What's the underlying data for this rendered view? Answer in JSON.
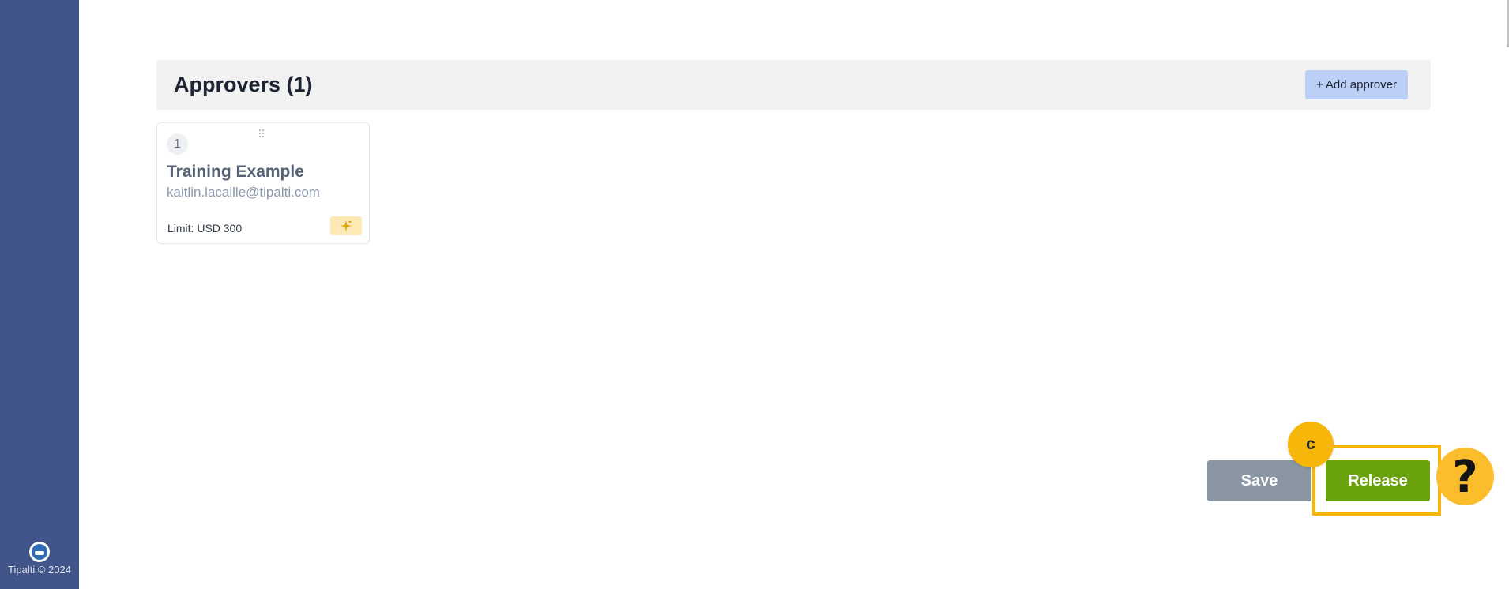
{
  "sidebar": {
    "copyright": "Tipalti © 2024"
  },
  "approvers": {
    "title": "Approvers (1)",
    "add_button_label": "+ Add approver",
    "items": [
      {
        "order": "1",
        "name": "Training Example",
        "email": "kaitlin.lacaille@tipalti.com",
        "limit": "Limit: USD 300"
      }
    ]
  },
  "actions": {
    "save_label": "Save",
    "release_label": "Release"
  },
  "guide": {
    "step_marker": "c",
    "help_label": "?"
  },
  "colors": {
    "sidebar": "#41558a",
    "release": "#6aa20b",
    "save": "#8a97a3",
    "highlight": "#f7b60a",
    "add_button": "#bcd0f7"
  },
  "icons": {
    "drag": "drag-handle-icon",
    "sparkle": "sparkle-icon",
    "logo": "tipalti-logo-icon",
    "help": "help-question-icon"
  }
}
